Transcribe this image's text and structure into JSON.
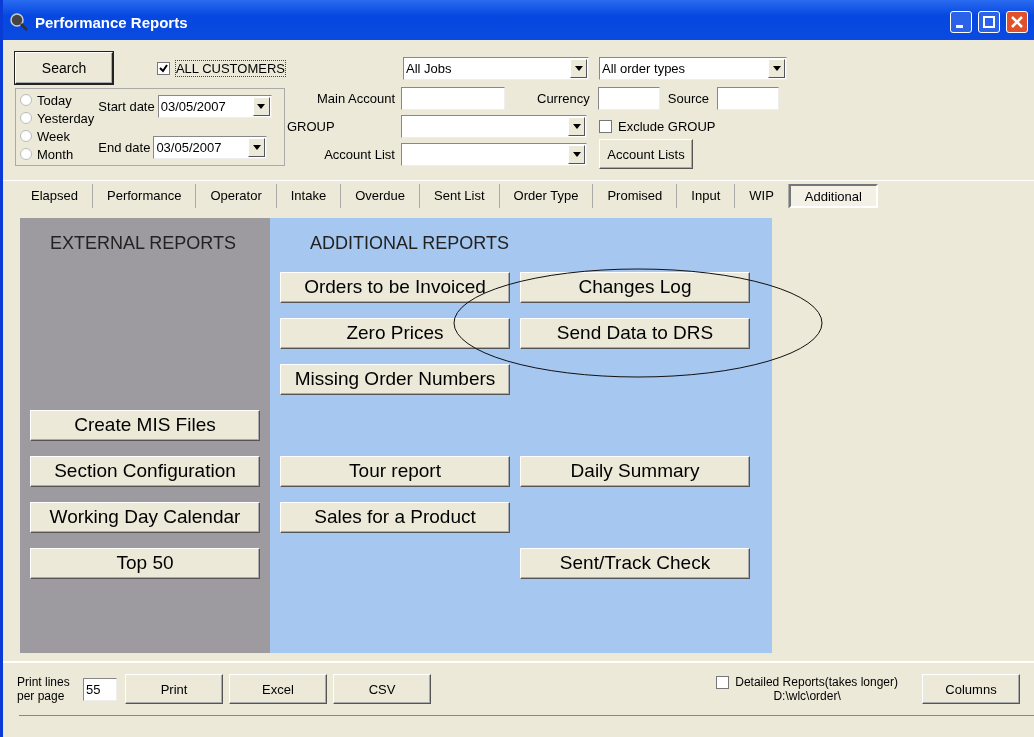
{
  "window": {
    "title": "Performance Reports"
  },
  "search_button": "Search",
  "all_customers": {
    "label": "ALL CUSTOMERS",
    "checked": true
  },
  "jobs_combo": {
    "value": "All Jobs"
  },
  "order_types_combo": {
    "value": "All order types"
  },
  "fields": [
    {
      "label": "Main Account",
      "kind": "text"
    },
    {
      "label": "GROUP",
      "kind": "combo"
    },
    {
      "label": "Account List",
      "kind": "combo"
    }
  ],
  "currency": {
    "label": "Currency"
  },
  "source": {
    "label": "Source"
  },
  "exclude_group": {
    "label": "Exclude GROUP",
    "checked": false
  },
  "account_lists_button": "Account Lists",
  "periods": [
    {
      "label": "Today",
      "selected": false
    },
    {
      "label": "Yesterday",
      "selected": false
    },
    {
      "label": "Week",
      "selected": false
    },
    {
      "label": "Month",
      "selected": false
    }
  ],
  "start_date": {
    "label": "Start date",
    "value": "03/05/2007"
  },
  "end_date": {
    "label": "End date",
    "value": "03/05/2007"
  },
  "tabs": [
    {
      "label": "Elapsed",
      "selected": false
    },
    {
      "label": "Performance",
      "selected": false
    },
    {
      "label": "Operator",
      "selected": false
    },
    {
      "label": "Intake",
      "selected": false
    },
    {
      "label": "Overdue",
      "selected": false
    },
    {
      "label": "Sent List",
      "selected": false
    },
    {
      "label": "Order Type",
      "selected": false
    },
    {
      "label": "Promised",
      "selected": false
    },
    {
      "label": "Input",
      "selected": false
    },
    {
      "label": "WIP",
      "selected": false
    },
    {
      "label": "Additional",
      "selected": true
    }
  ],
  "external_reports": {
    "title": "EXTERNAL REPORTS",
    "buttons": [
      {
        "label": "Create MIS Files"
      },
      {
        "label": "Section Configuration"
      },
      {
        "label": "Working Day Calendar"
      },
      {
        "label": "Top 50"
      }
    ]
  },
  "additional_reports": {
    "title": "ADDITIONAL REPORTS",
    "buttons": [
      {
        "label": "Orders to be Invoiced"
      },
      {
        "label": "Changes Log"
      },
      {
        "label": "Zero Prices"
      },
      {
        "label": "Send Data to DRS"
      },
      {
        "label": "Missing Order Numbers"
      },
      {
        "label": "Tour report"
      },
      {
        "label": "Daily Summary"
      },
      {
        "label": "Sales for a Product"
      },
      {
        "label": "Sent/Track Check"
      }
    ]
  },
  "bottom": {
    "print_lines_label": "Print lines per page",
    "print_lines_value": "55",
    "buttons": [
      "Print",
      "Excel",
      "CSV"
    ],
    "detailed": {
      "label": "Detailed Reports(takes longer)",
      "checked": false
    },
    "path": "D:\\wlc\\order\\",
    "columns_button": "Columns"
  }
}
